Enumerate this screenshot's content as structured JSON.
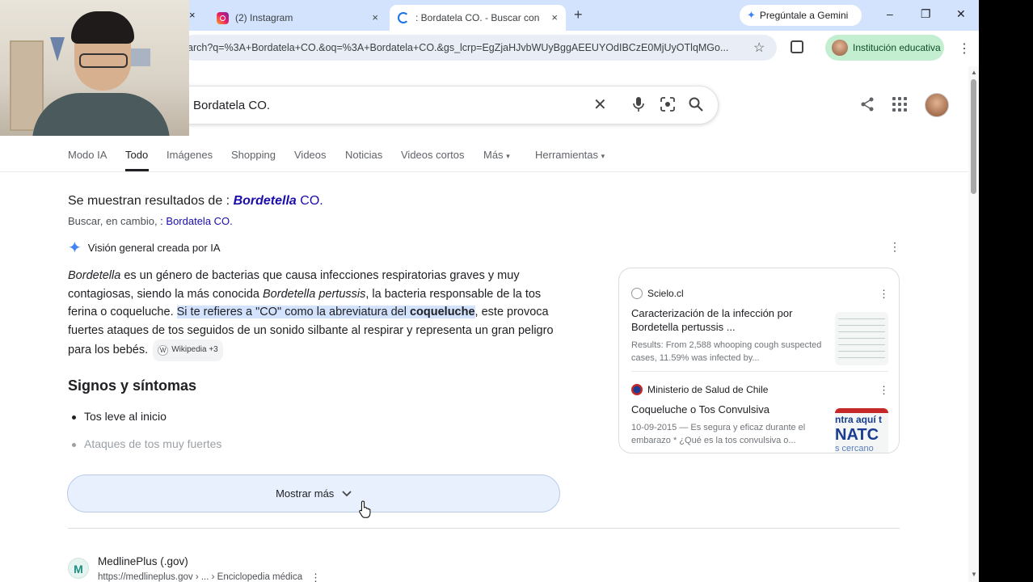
{
  "browser": {
    "tabs": [
      {
        "title": "(2) Instagram",
        "close": "×"
      },
      {
        "title": ": Bordatela CO. - Buscar con Go",
        "close": "×"
      }
    ],
    "new_tab": "+",
    "gemini_label": "Pregúntale a Gemini",
    "window_controls": {
      "minimize": "–",
      "maximize": "❐",
      "close": "✕"
    },
    "url": "arch?q=%3A+Bordatela+CO.&oq=%3A+Bordatela+CO.&gs_lcrp=EgZjaHJvbWUyBggAEEUYOdIBCzE0MjUyOTlqMGo...",
    "profile_label": "Institución educativa",
    "partial_tab_close": "×"
  },
  "search": {
    "query": "Bordatela CO.",
    "tabs": [
      "Modo IA",
      "Todo",
      "Imágenes",
      "Shopping",
      "Videos",
      "Noticias",
      "Videos cortos",
      "Más",
      "Herramientas"
    ],
    "active_tab": "Todo"
  },
  "correction": {
    "showing_prefix": "Se muestran resultados de : ",
    "showing_bold": "Bordetella",
    "showing_rest": " CO.",
    "instead_prefix": "Buscar, en cambio, ",
    "instead_link": ": Bordatela CO."
  },
  "ai_overview": {
    "header": "Visión general creada por IA",
    "p1_italic": "Bordetella",
    "p1_a": " es un género de bacterias que causa infecciones respiratorias graves y muy contagiosas, siendo la más conocida ",
    "p1_italic2": "Bordetella pertussis",
    "p1_b": ", la bacteria responsable de la tos ferina o coqueluche. ",
    "p1_hl": "Si te refieres a \"CO\" como la abreviatura del ",
    "p1_hl_bold": "coqueluche",
    "p1_c": ", este provoca fuertes ataques de tos seguidos de un sonido silbante al respirar y representa un gran peligro para los bebés.",
    "source_badge": "Wikipedia +3",
    "section_title": "Signos y síntomas",
    "bullets": [
      "Tos leve al inicio",
      "Ataques de tos muy fuertes"
    ],
    "show_more": "Mostrar más"
  },
  "sources": [
    {
      "site": "Scielo.cl",
      "title": "Caracterización de la infección por Bordetella pertussis ...",
      "desc": "Results: From 2,588 whooping cough suspected cases, 11.59% was infected by..."
    },
    {
      "site": "Ministerio de Salud de Chile",
      "title": "Coqueluche o Tos Convulsiva",
      "desc": "10-09-2015 — Es segura y eficaz durante el embarazo * ¿Qué es la tos convulsiva o...",
      "thumb_lines": [
        "ntra aquí t",
        "NATC",
        "s cercano"
      ]
    }
  ],
  "results": [
    {
      "name": "MedlinePlus (.gov)",
      "url": "https://medlineplus.gov › ... › Enciclopedia médica"
    }
  ],
  "colors": {
    "link": "#1a0dab",
    "tabbar": "#d3e3fd",
    "highlight": "#d3e3fd",
    "profile_chip": "#c4eed0"
  },
  "icons": [
    "instagram-icon",
    "google-loading-icon",
    "gemini-sparkle-icon",
    "star-icon",
    "extensions-icon",
    "kebab-icon",
    "clear-icon",
    "mic-icon",
    "lens-icon",
    "search-icon",
    "share-icon",
    "apps-icon",
    "ai-sparkle-icon",
    "chevron-down-icon",
    "medlineplus-icon"
  ]
}
